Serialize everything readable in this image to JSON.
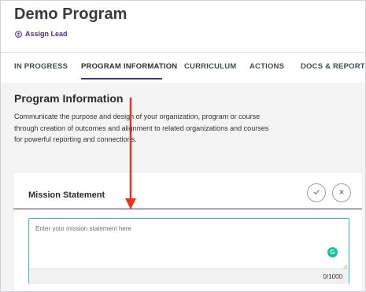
{
  "header": {
    "title": "Demo Program",
    "assign_lead_label": "Assign Lead"
  },
  "tabs": [
    {
      "label": "IN PROGRESS",
      "active": false
    },
    {
      "label": "PROGRAM INFORMATION",
      "active": true
    },
    {
      "label": "CURRICULUM",
      "active": false
    },
    {
      "label": "ACTIONS",
      "active": false
    },
    {
      "label": "DOCS & REPORTS",
      "active": false
    }
  ],
  "section": {
    "title": "Program Information",
    "description": "Communicate the purpose and design of your organization, program or course through creation of outcomes and alignment to related organizations and courses for powerful reporting and connections."
  },
  "mission_card": {
    "title": "Mission Statement",
    "placeholder": "Enter your mission statement here",
    "value": "",
    "counter": "0/1000",
    "grammarly_badge": "G"
  },
  "colors": {
    "accent": "#4a2f8c",
    "focus_border": "#2bbfc4",
    "annotation_arrow": "#e8331e",
    "grammarly": "#15c39a"
  },
  "icons": {
    "assign_lead": "user-circle-icon",
    "confirm": "check-icon",
    "cancel": "close-icon",
    "grammarly": "grammarly-icon",
    "annotation": "red-arrow-annotation"
  }
}
